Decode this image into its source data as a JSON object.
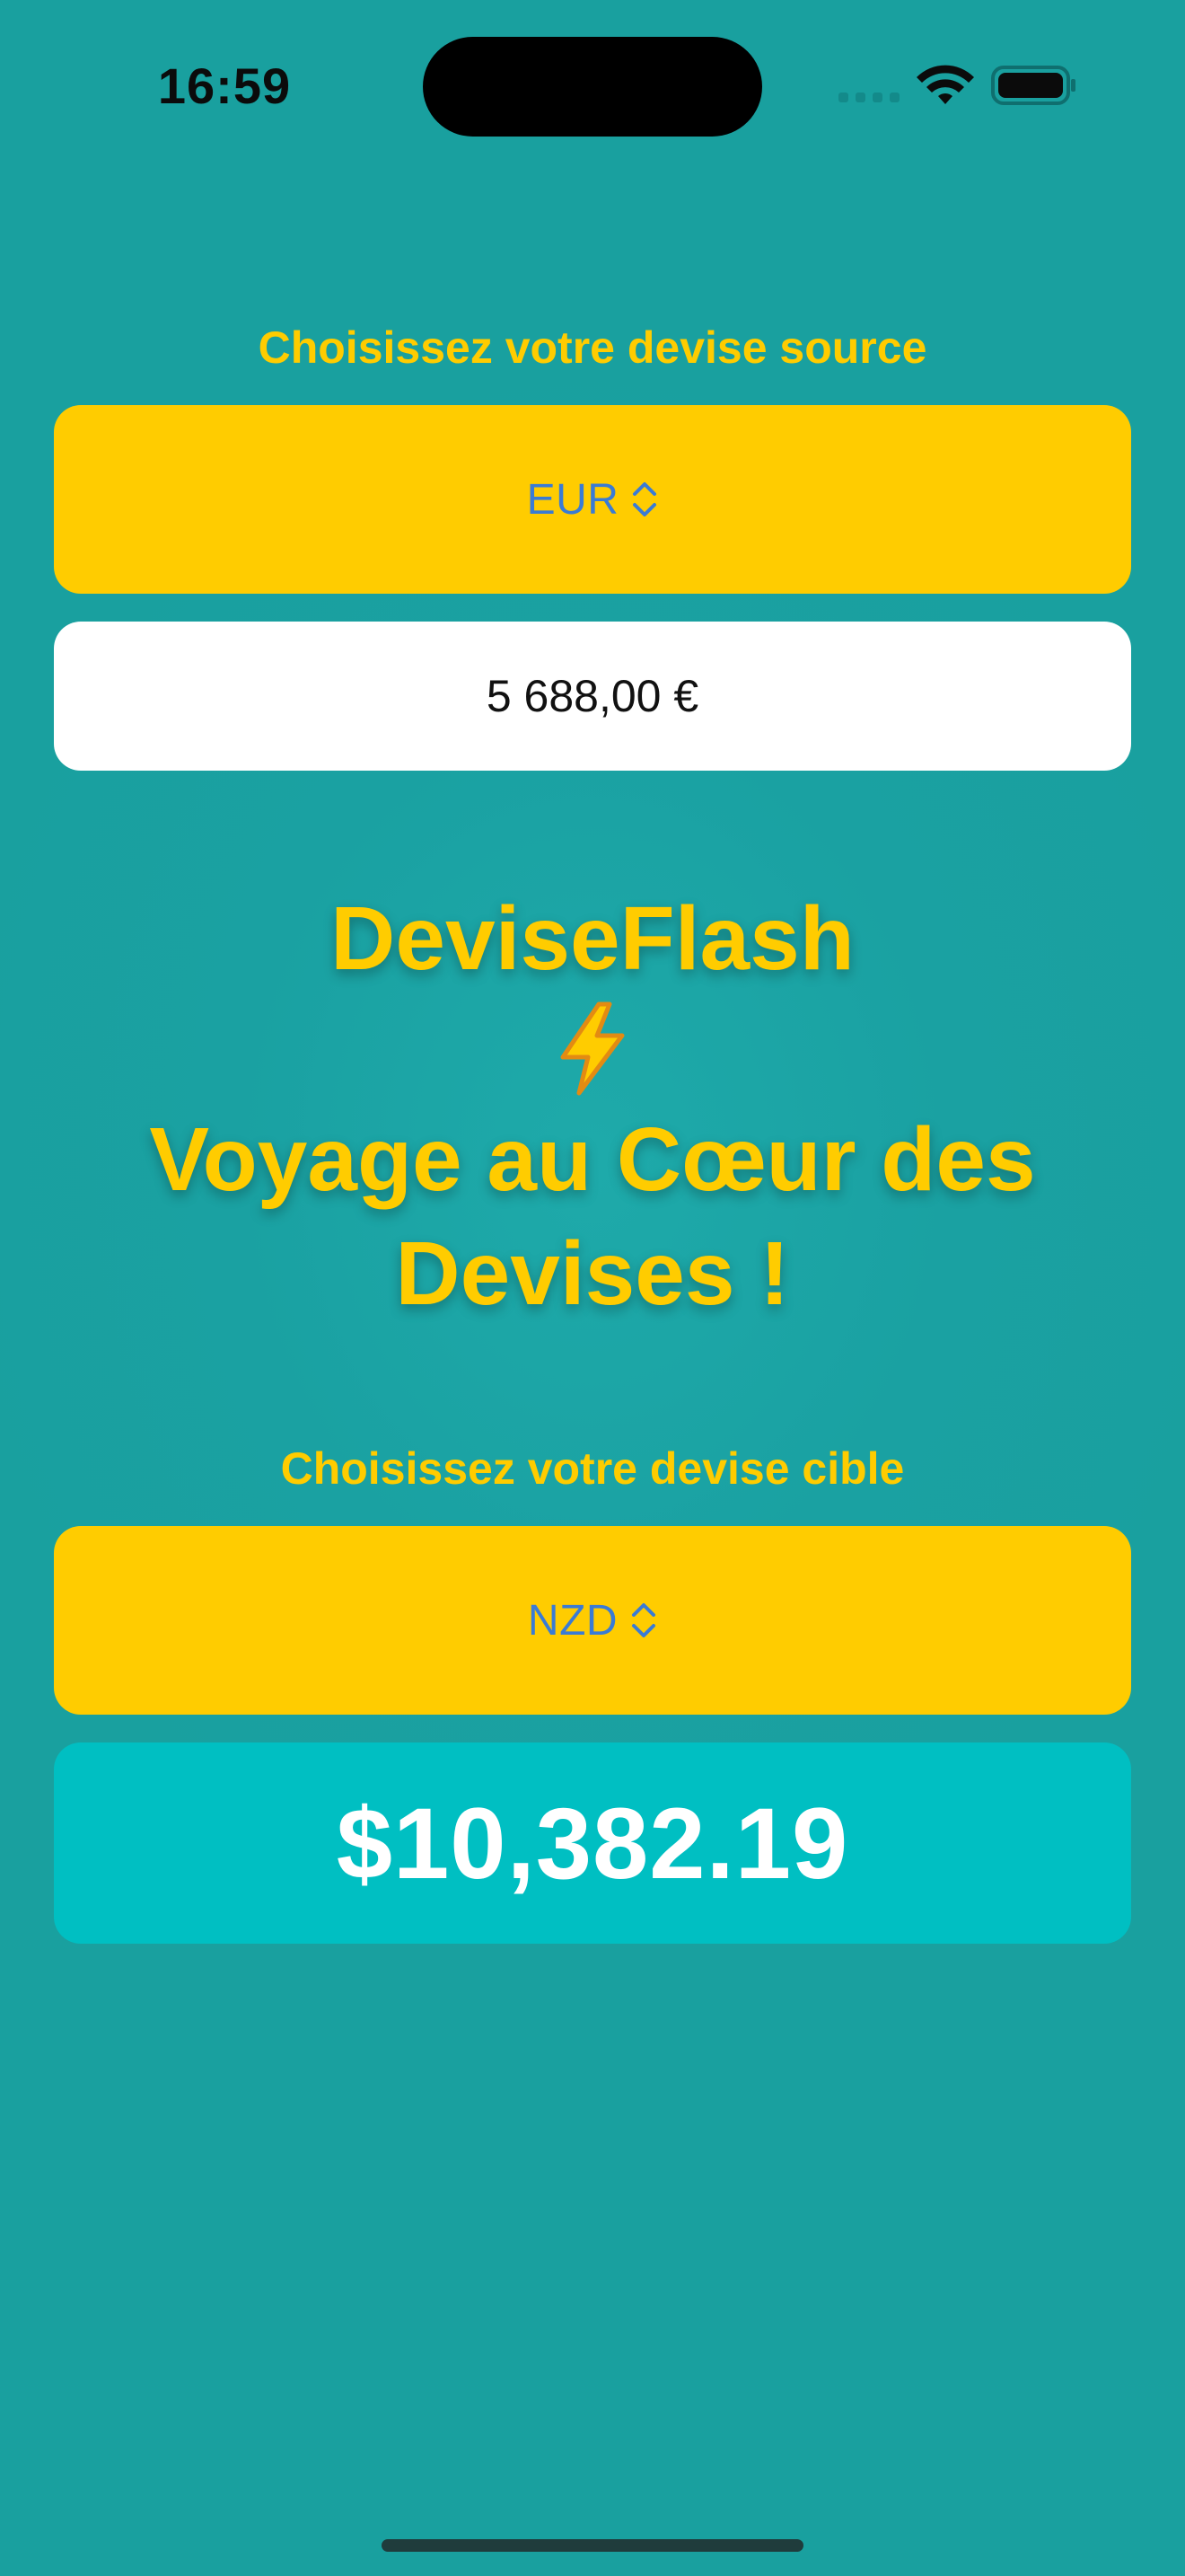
{
  "status_bar": {
    "time": "16:59",
    "icons": [
      "cellular-signal-icon",
      "wifi-icon",
      "battery-icon"
    ]
  },
  "converter": {
    "source_label": "Choisissez votre devise source",
    "source_currency": "EUR",
    "amount_value": "5 688,00 €",
    "title": "DeviseFlash",
    "title_emoji": "⚡",
    "tagline": "Voyage au Cœur des Devises !",
    "target_label": "Choisissez votre devise cible",
    "target_currency": "NZD",
    "result": "$10,382.19"
  },
  "colors": {
    "background": "#1aa1a2",
    "accent_yellow": "#ffcc00",
    "picker_text": "#3a7bd5",
    "result_box": "#00bfc2",
    "result_text": "#ffffff"
  }
}
